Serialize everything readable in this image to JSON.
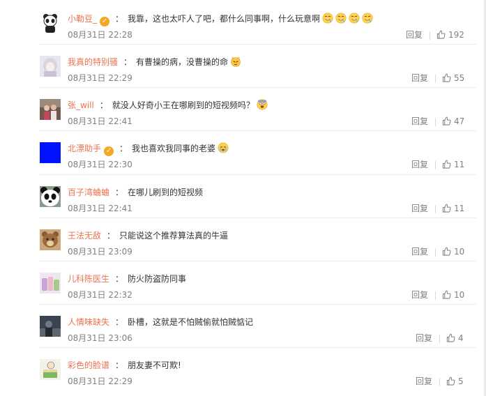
{
  "reply_label": "回复",
  "comments": [
    {
      "user": "小勒豆_",
      "verified": true,
      "text": "我靠，这也太吓人了吧，都什么同事啊，什么玩意啊",
      "emoji": [
        "drool-face-emoji",
        "drool-face-emoji",
        "drool-face-emoji",
        "drool-face-emoji"
      ],
      "time": "08月31日 22:28",
      "likes": "192"
    },
    {
      "user": "我真的特别骚",
      "verified": false,
      "text": "有曹操的病，没曹操的命",
      "emoji": [
        "cat-face-emoji"
      ],
      "time": "08月31日 22:29",
      "likes": "55"
    },
    {
      "user": "张_will",
      "verified": false,
      "text": "就没人好奇小王在哪刷到的短视频吗？",
      "emoji": [
        "scared-face-emoji"
      ],
      "time": "08月31日 22:41",
      "likes": "47"
    },
    {
      "user": "北漂助手",
      "verified": true,
      "text": "我也喜欢我同事的老婆",
      "emoji": [
        "crying-face-emoji"
      ],
      "time": "08月31日 22:30",
      "likes": "11"
    },
    {
      "user": "百子湾蛐蛐",
      "verified": false,
      "text": "在哪儿刷到的短视频",
      "emoji": [],
      "time": "08月31日 22:41",
      "likes": "11"
    },
    {
      "user": "王法无敌",
      "verified": false,
      "text": "只能说这个推荐算法真的牛逼",
      "emoji": [],
      "time": "08月31日 23:09",
      "likes": "10"
    },
    {
      "user": "儿科陈医生",
      "verified": false,
      "text": "防火防盗防同事",
      "emoji": [],
      "time": "08月31日 22:32",
      "likes": "10"
    },
    {
      "user": "人情味缺失",
      "verified": false,
      "text": "卧槽，这就是不怕贼偷就怕贼惦记",
      "emoji": [],
      "time": "08月31日 23:06",
      "likes": "4"
    },
    {
      "user": "彩色的脸谱",
      "verified": false,
      "text": "朋友妻不可欺!",
      "emoji": [],
      "time": "08月31日 22:29",
      "likes": "5"
    }
  ]
}
